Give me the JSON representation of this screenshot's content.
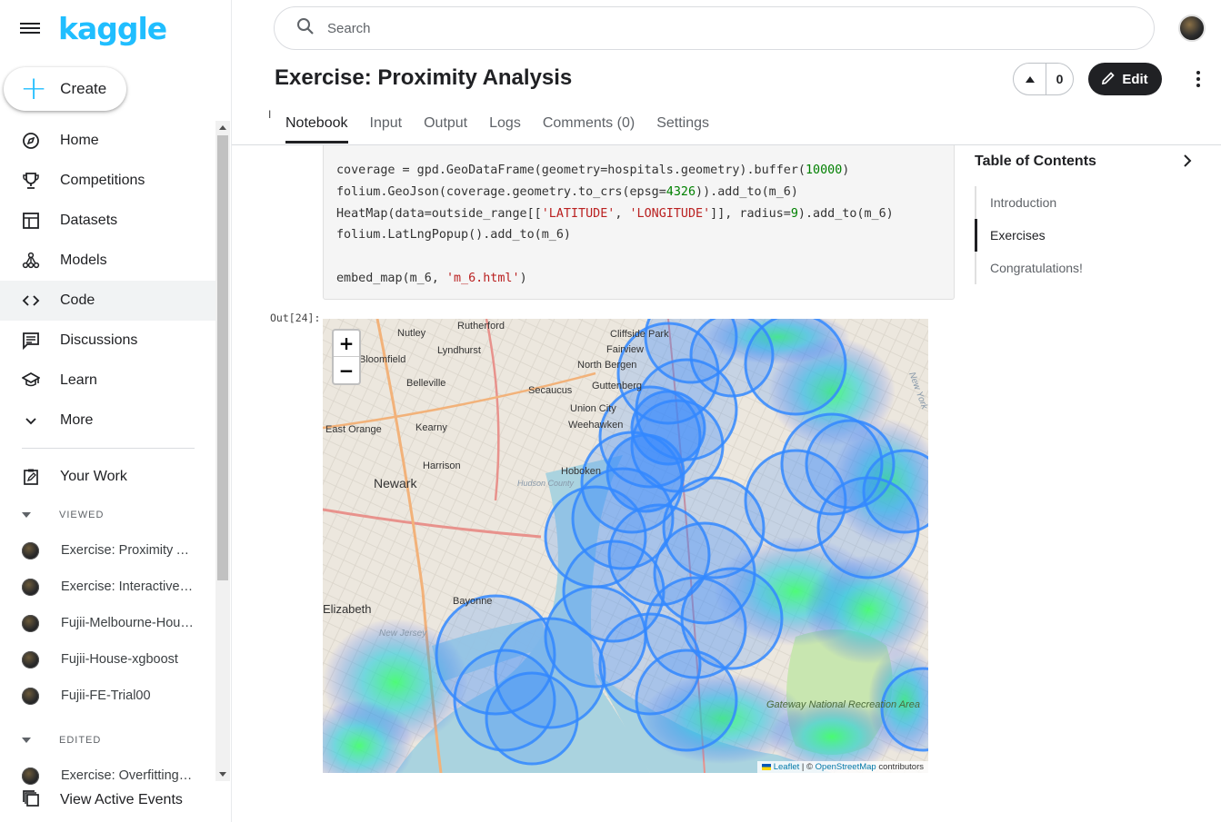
{
  "sidebar": {
    "logo": "kaggle",
    "create_label": "Create",
    "nav": [
      {
        "label": "Home",
        "icon": "compass-icon"
      },
      {
        "label": "Competitions",
        "icon": "trophy-icon"
      },
      {
        "label": "Datasets",
        "icon": "table-icon"
      },
      {
        "label": "Models",
        "icon": "models-icon"
      },
      {
        "label": "Code",
        "icon": "code-icon"
      },
      {
        "label": "Discussions",
        "icon": "discussion-icon"
      },
      {
        "label": "Learn",
        "icon": "school-icon"
      },
      {
        "label": "More",
        "icon": "chevron-down-icon"
      }
    ],
    "active_nav": "Code",
    "your_work": "Your Work",
    "viewed_header": "VIEWED",
    "viewed": [
      "Exercise: Proximity Analysis",
      "Exercise: Interactive Maps",
      "Fujii-Melbourne-House-Prices",
      "Fujii-House-xgboost",
      "Fujii-FE-Trial00"
    ],
    "edited_header": "EDITED",
    "edited": [
      "Exercise: Overfitting and Underfitting"
    ],
    "active_events": "View Active Events"
  },
  "header": {
    "search_placeholder": "Search",
    "title": "Exercise: Proximity Analysis",
    "vote_count": "0",
    "edit_label": "Edit",
    "tabs": [
      "Notebook",
      "Input",
      "Output",
      "Logs",
      "Comments (0)",
      "Settings"
    ],
    "active_tab": "Notebook"
  },
  "cell": {
    "out_prompt": "Out[24]:"
  },
  "map": {
    "zoom_in": "+",
    "zoom_out": "−",
    "attribution_leaflet": "Leaflet",
    "attribution_sep": " | © ",
    "attribution_osm": "OpenStreetMap",
    "attribution_tail": " contributors",
    "place_labels": [
      "Rutherford",
      "Nutley",
      "Lyndhurst",
      "Cliffside Park",
      "Fairview",
      "North Bergen",
      "Bloomfield",
      "Belleville",
      "Secaucus",
      "Guttenberg",
      "Union City",
      "Weehawken",
      "East Orange",
      "Kearny",
      "Harrison",
      "Newark",
      "Hoboken",
      "Hudson County",
      "Bayonne",
      "Elizabeth",
      "New Jersey",
      "Gateway National Recreation Area",
      "New York"
    ]
  },
  "toc": {
    "title": "Table of Contents",
    "items": [
      "Introduction",
      "Exercises",
      "Congratulations!"
    ],
    "active": "Exercises"
  },
  "colors": {
    "brand": "#20beff",
    "buffer_stroke": "#3388ff",
    "buffer_fill": "#3388ff"
  }
}
